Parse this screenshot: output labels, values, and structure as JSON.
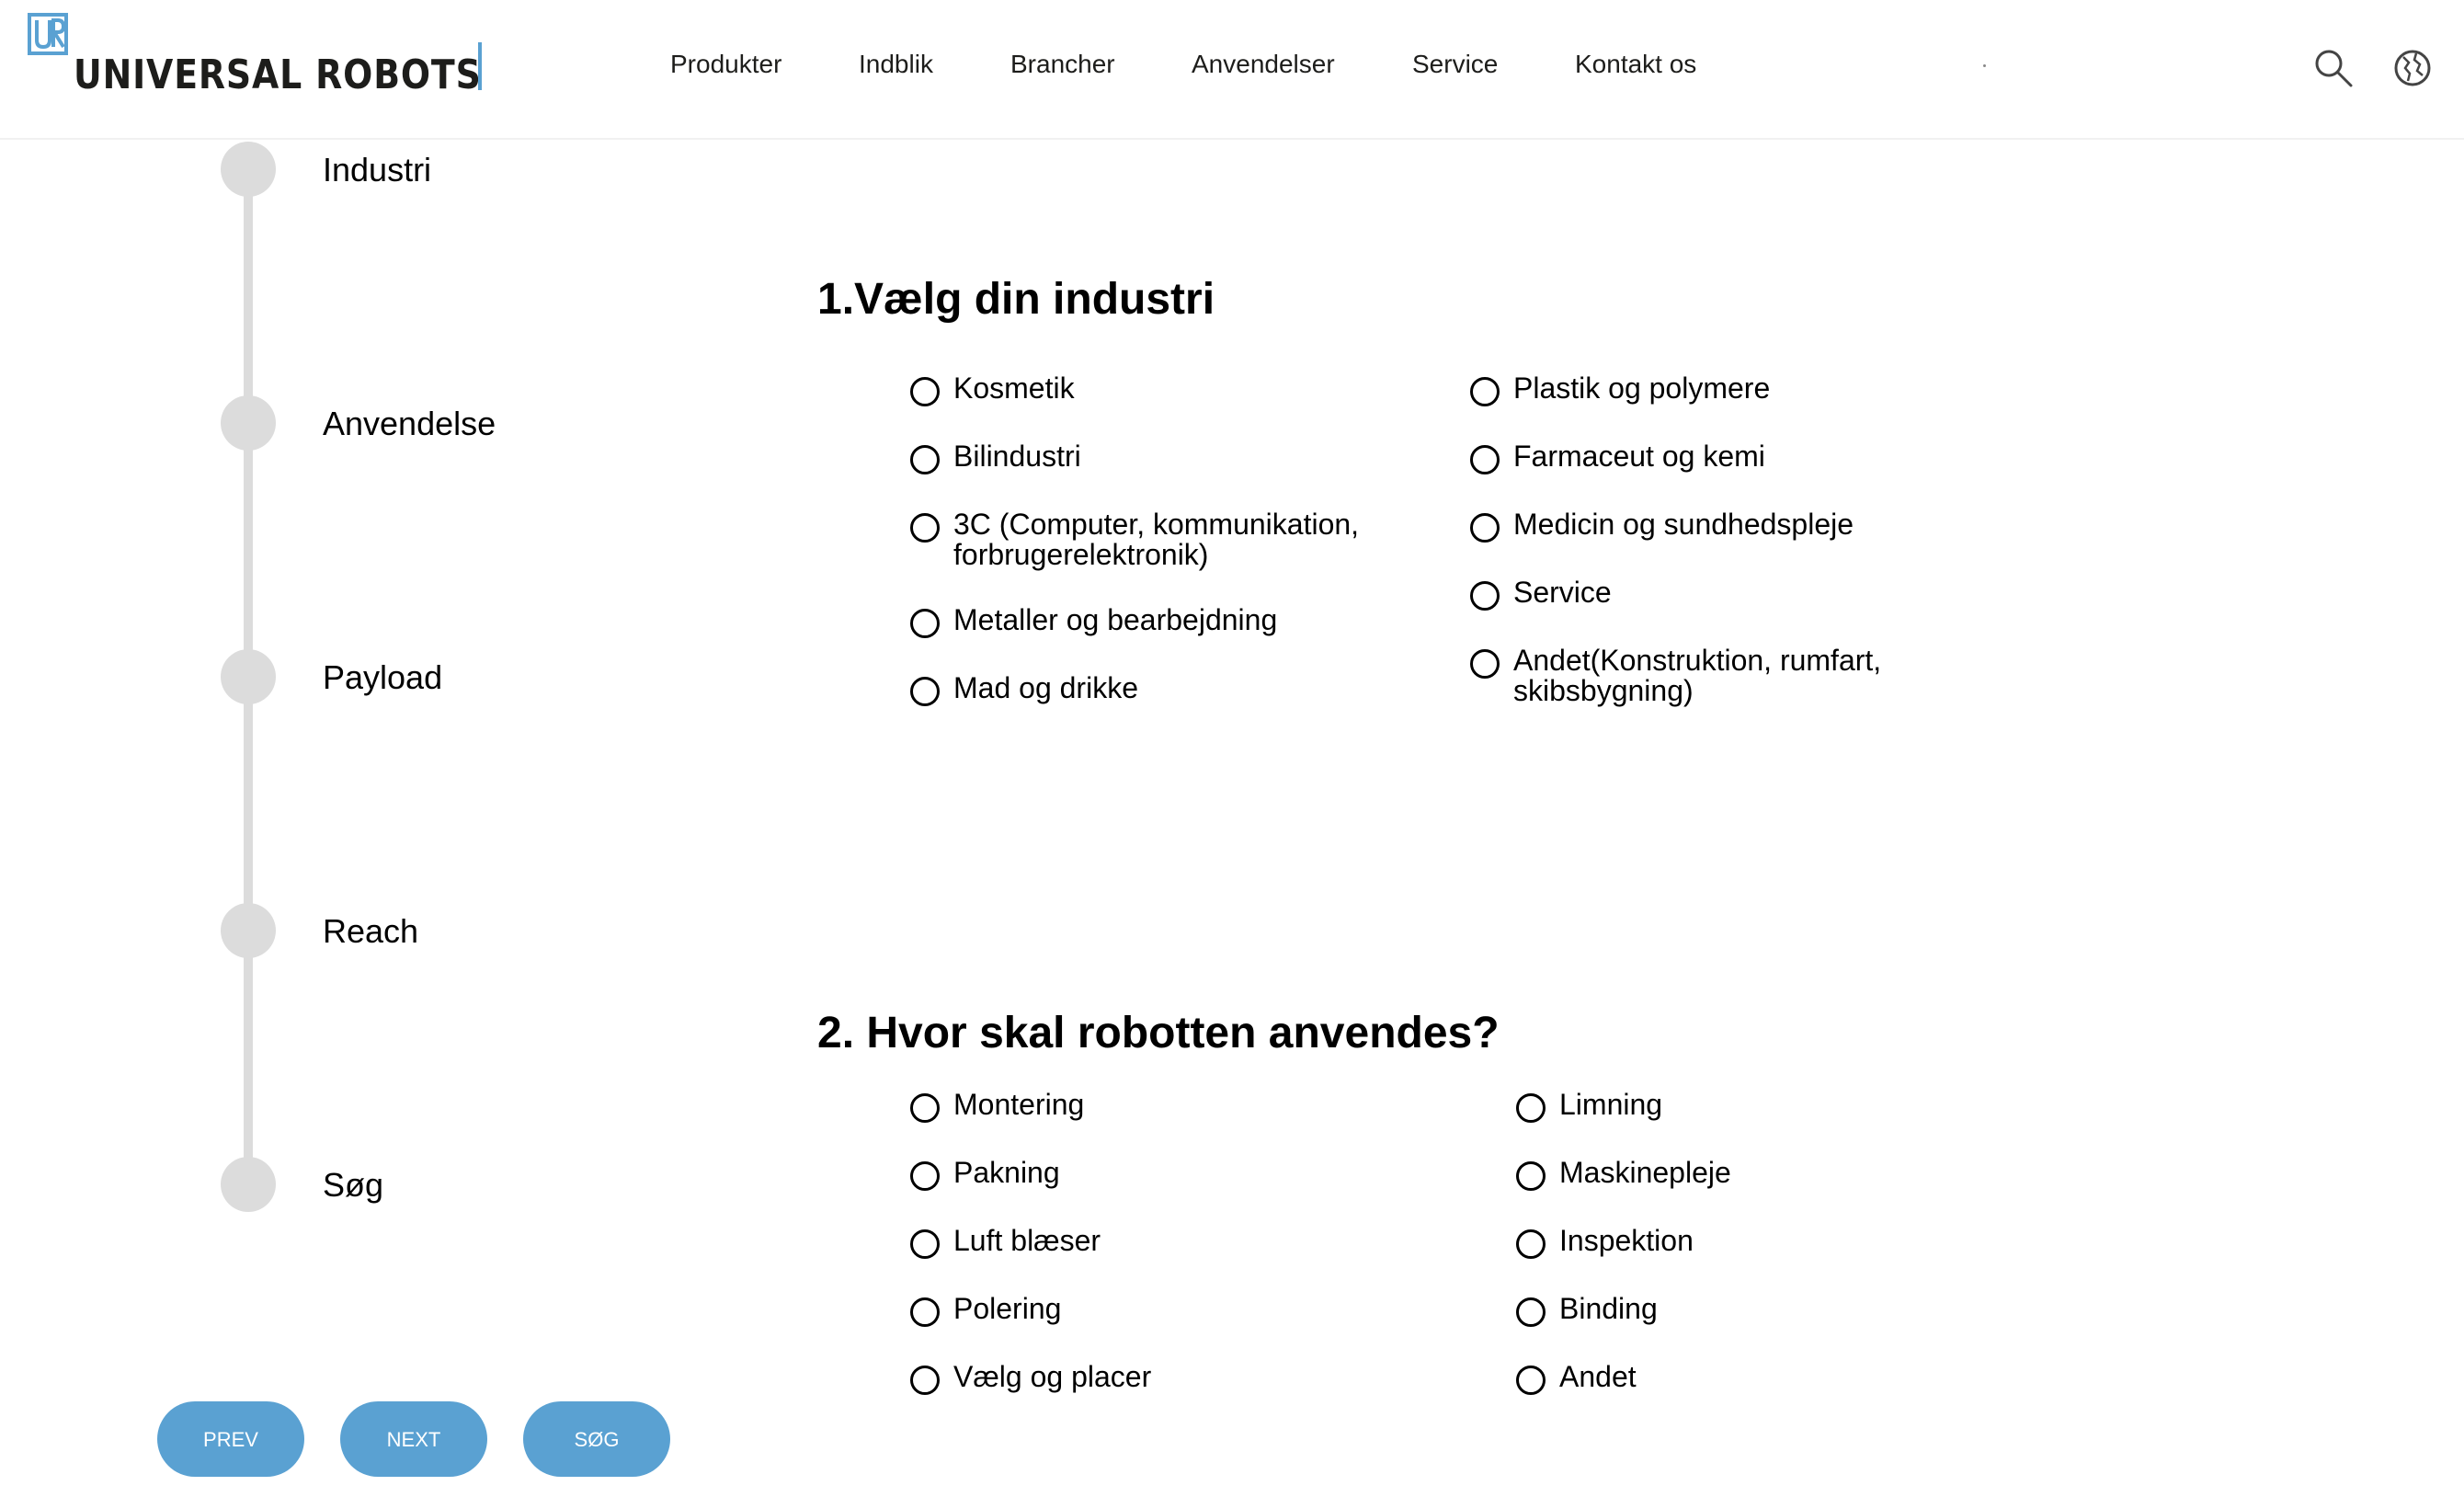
{
  "header": {
    "logo_text": "UNIVERSAL ROBOTS",
    "nav": [
      "Produkter",
      "Indblik",
      "Brancher",
      "Anvendelser",
      "Service",
      "Kontakt os"
    ],
    "icons": [
      "search-icon",
      "globe-icon"
    ]
  },
  "steps": [
    "Industri",
    "Anvendelse",
    "Payload",
    "Reach",
    "Søg"
  ],
  "q1": {
    "title": "1.Vælg din industri",
    "options": [
      "Kosmetik",
      "Bilindustri",
      "3C (Computer, kommunikation, forbrugerelektronik)",
      "Metaller og bearbejdning",
      "Mad og drikke",
      "Plastik og polymere",
      "Farmaceut og kemi",
      "Medicin og sundhedspleje",
      "Service",
      "Andet(Konstruktion, rumfart, skibsbygning)"
    ]
  },
  "q2": {
    "title": "2. Hvor skal robotten anvendes?",
    "options": [
      "Montering",
      "Pakning",
      "Luft blæser",
      "Polering",
      "Vælg og placer",
      "Limning",
      "Maskinepleje",
      "Inspektion",
      "Binding",
      "Andet"
    ]
  },
  "buttons": {
    "prev": "PREV",
    "next": "NEXT",
    "search": "SØG"
  },
  "colors": {
    "accent": "#5aa1d2",
    "step_gray": "#dcdcdc",
    "text": "#000000"
  }
}
